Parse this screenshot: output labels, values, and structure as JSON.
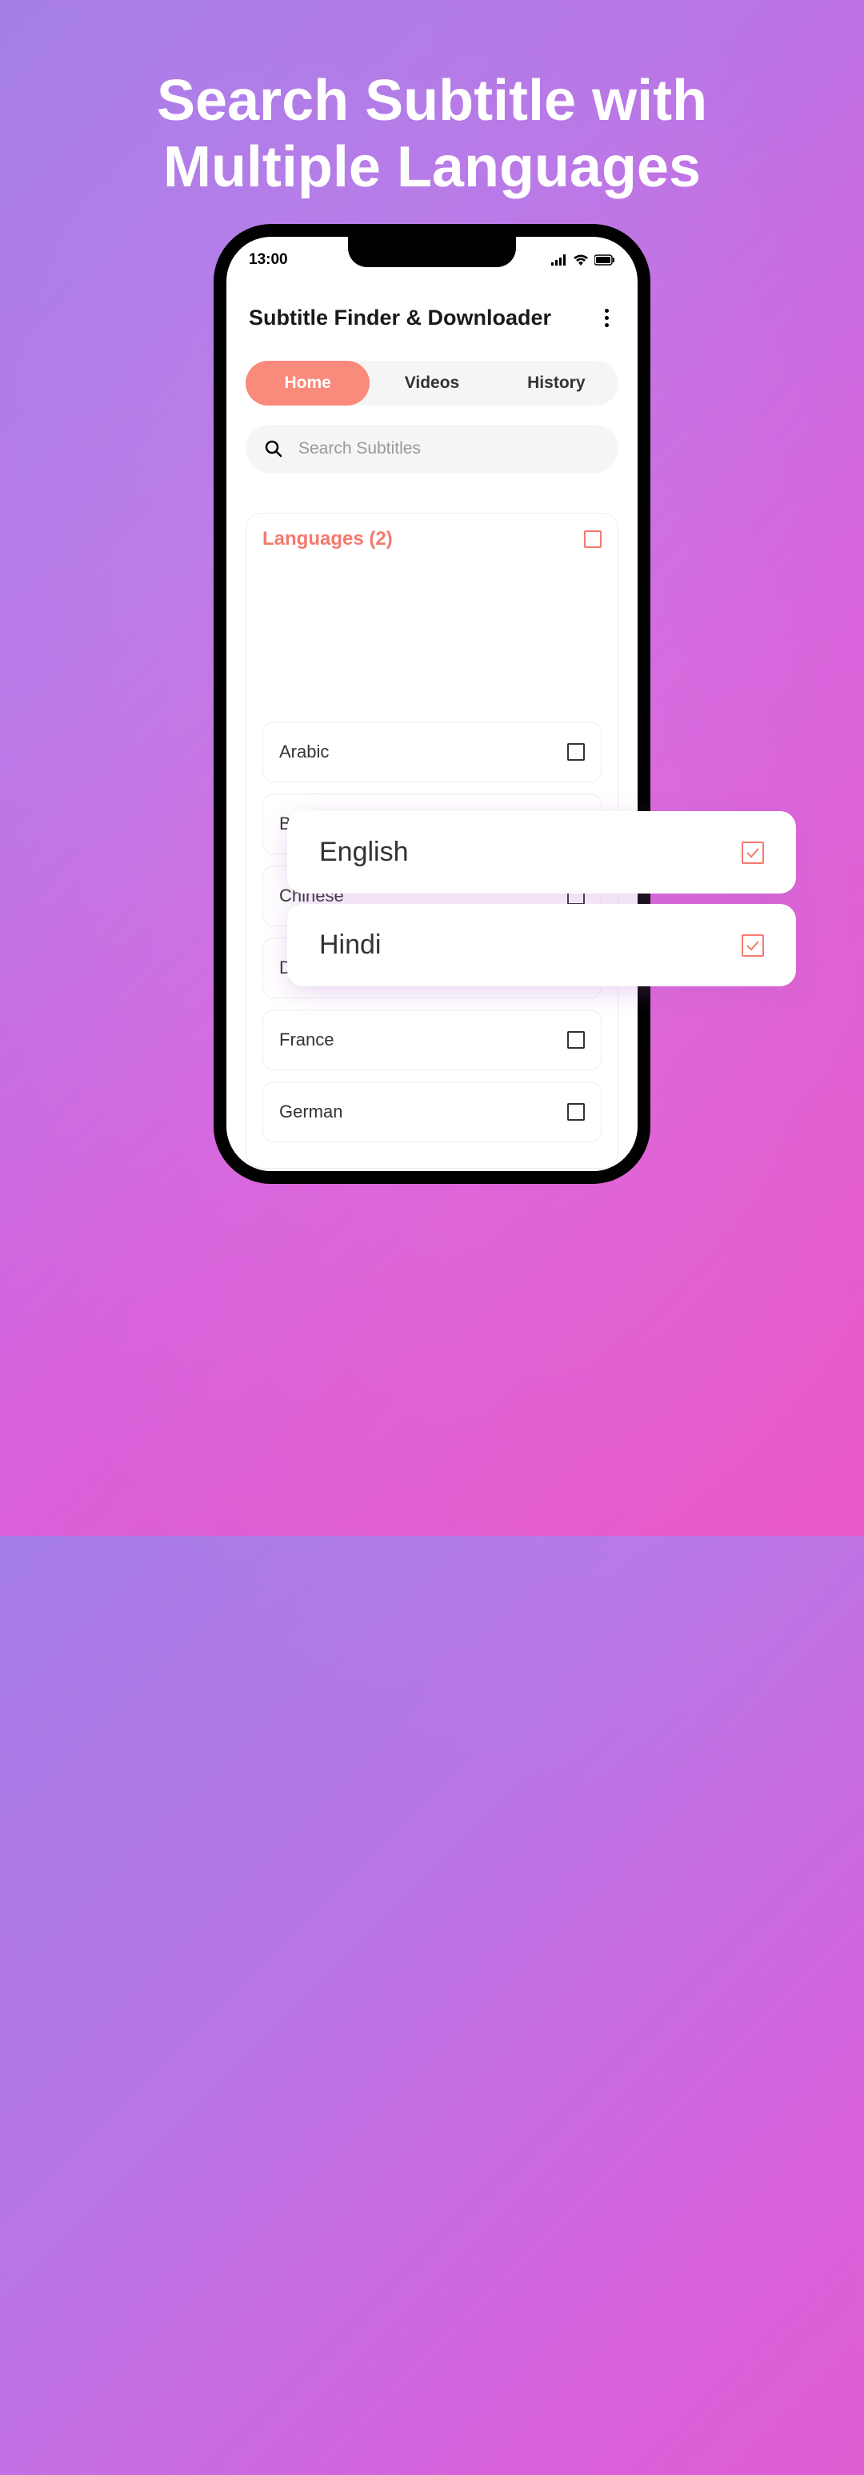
{
  "hero": {
    "title": "Search Subtitle with Multiple Languages"
  },
  "statusBar": {
    "time": "13:00"
  },
  "appHeader": {
    "title": "Subtitle Finder & Downloader"
  },
  "tabs": {
    "home": "Home",
    "videos": "Videos",
    "history": "History"
  },
  "search": {
    "placeholder": "Search Subtitles"
  },
  "languagesPanel": {
    "title": "Languages (2)"
  },
  "selectedLanguages": [
    {
      "label": "English"
    },
    {
      "label": "Hindi"
    }
  ],
  "languages": [
    {
      "label": "Arabic"
    },
    {
      "label": "Bengali"
    },
    {
      "label": "Chinese"
    },
    {
      "label": "Danish"
    },
    {
      "label": "France"
    },
    {
      "label": "German"
    }
  ]
}
